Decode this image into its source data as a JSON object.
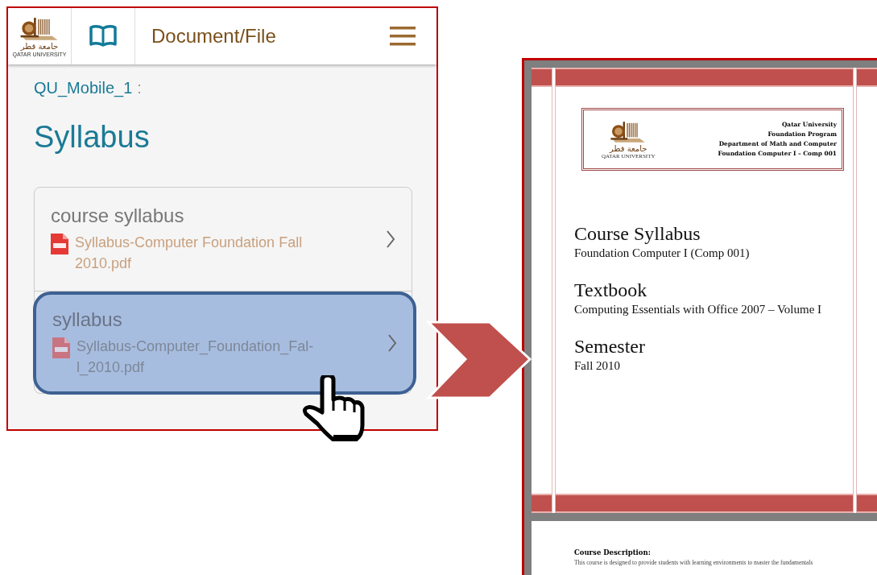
{
  "phone": {
    "header": {
      "logo_arabic": "جامعة قطر",
      "logo_english": "QATAR UNIVERSITY",
      "title": "Document/File"
    },
    "breadcrumb": {
      "name": "QU_Mobile_1",
      "separator": ":"
    },
    "heading": "Syllabus",
    "items": [
      {
        "label": "course syllabus",
        "file": "Syllabus-Computer Foundation Fall 2010.pdf",
        "selected": false
      },
      {
        "label": "syllabus",
        "file": "Syllabus-Computer_Foundation_Fal-l_2010.pdf",
        "selected": true
      }
    ]
  },
  "document": {
    "logo_arabic": "جامعة قطر",
    "logo_english": "QATAR UNIVERSITY",
    "header_lines": [
      "Qatar University",
      "Foundation Program",
      "Department of Math and Computer",
      "Foundation Computer I – Comp 001"
    ],
    "sections": [
      {
        "title": "Course Syllabus",
        "subtitle": "Foundation Computer I (Comp 001)"
      },
      {
        "title": "Textbook",
        "subtitle": "Computing Essentials with Office 2007 – Volume I"
      },
      {
        "title": "Semester",
        "subtitle": "Fall 2010"
      }
    ],
    "page2": {
      "heading": "Course Description:",
      "text": "This course is designed to provide students with learning environments to master the fundamentals"
    }
  }
}
